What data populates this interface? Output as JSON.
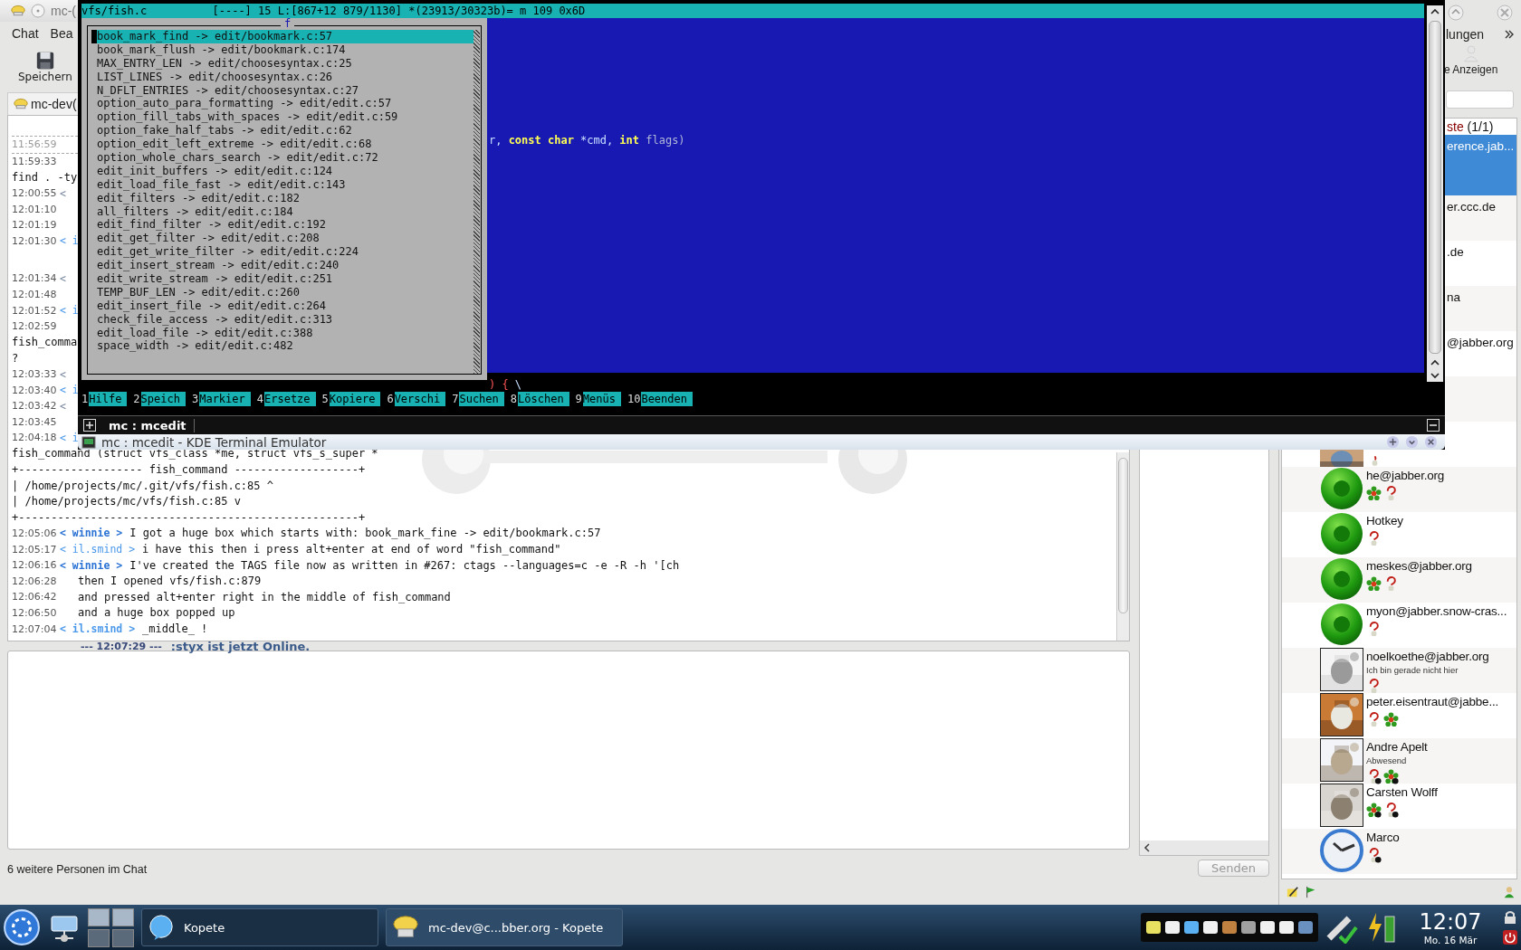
{
  "chat_window": {
    "title": "mc-(",
    "menu": [
      "Chat",
      "Bea"
    ],
    "toolbar": [
      {
        "label": "Speichern"
      }
    ],
    "tab": "mc-dev(",
    "log": [
      {
        "kind": "divider",
        "time": "11:56:59"
      },
      {
        "kind": "time",
        "time": "11:59:33"
      },
      {
        "kind": "text",
        "text": "find . -ty"
      },
      {
        "kind": "message",
        "time": "12:00:55",
        "nick": "<"
      },
      {
        "kind": "time",
        "time": "12:01:10"
      },
      {
        "kind": "time",
        "time": "12:01:19"
      },
      {
        "kind": "message",
        "time": "12:01:30",
        "nick": "< i",
        "color": "#4a98ea"
      },
      {
        "kind": "blank"
      },
      {
        "kind": "message",
        "time": "12:01:34",
        "nick": "<"
      },
      {
        "kind": "time",
        "time": "12:01:48"
      },
      {
        "kind": "message",
        "time": "12:01:52",
        "nick": "< i",
        "color": "#4a98ea"
      },
      {
        "kind": "time",
        "time": "12:02:59"
      },
      {
        "kind": "text",
        "text": "fish_comma"
      },
      {
        "kind": "text",
        "text": "?"
      },
      {
        "kind": "message",
        "time": "12:03:33",
        "nick": "<"
      },
      {
        "kind": "message",
        "time": "12:03:40",
        "nick": "< i",
        "color": "#4a98ea"
      },
      {
        "kind": "message",
        "time": "12:03:42",
        "nick": "<"
      },
      {
        "kind": "time",
        "time": "12:03:45"
      },
      {
        "kind": "message",
        "time": "12:04:18",
        "nick": "< i",
        "color": "#4a98ea"
      },
      {
        "kind": "text",
        "text": "fish_command (struct vfs_class *me, struct vfs_s_super *"
      },
      {
        "kind": "text",
        "text": "+------------------- fish_command -------------------+"
      },
      {
        "kind": "text",
        "text": "| /home/projects/mc/.git/vfs/fish.c:85 ^"
      },
      {
        "kind": "text",
        "text": "| /home/projects/mc/vfs/fish.c:85 v"
      },
      {
        "kind": "text",
        "text": "+----------------------------------------------------+"
      },
      {
        "kind": "message",
        "time": "12:05:06",
        "nick": "< winnie >",
        "color": "#2a72d4",
        "text": "I got a huge box which starts with: book_mark_fine -> edit/bookmark.c:57"
      },
      {
        "kind": "message",
        "time": "12:05:17",
        "nick": "< il.smind >",
        "color": "#4a98ea",
        "text": "i have this then i press alt+enter at end of word \"fish_command\""
      },
      {
        "kind": "message",
        "time": "12:06:16",
        "nick": "< winnie >",
        "color": "#2a72d4",
        "text": "I've created the TAGS file now as written in #267: ctags --languages=c -e -R -h '[ch"
      },
      {
        "kind": "continuation",
        "time": "12:06:28",
        "text": "then I opened vfs/fish.c:879"
      },
      {
        "kind": "continuation",
        "time": "12:06:42",
        "text": "and pressed alt+enter right in the middle of fish_command"
      },
      {
        "kind": "continuation",
        "time": "12:06:50",
        "text": "and a huge box popped up"
      },
      {
        "kind": "message",
        "time": "12:07:04",
        "nick": "< il.smind >",
        "color": "#4a98ea",
        "text": "_middle_ !"
      },
      {
        "kind": "system",
        "time": "--- 12:07:29 ---",
        "text": ":styx ist jetzt Online."
      }
    ],
    "status": "6 weitere Personen im Chat",
    "send_button": "Senden"
  },
  "terminal": {
    "status_line": "vfs/fish.c          [----] 15 L:[867+12 879/1130] *(23913/30323b)= m 109 0x6D",
    "popup": {
      "title": "f",
      "items": [
        {
          "text": "book_mark_find -> edit/bookmark.c:57",
          "selected": true
        },
        {
          "text": "book_mark_flush -> edit/bookmark.c:174",
          "selected": false
        },
        {
          "text": "MAX_ENTRY_LEN -> edit/choosesyntax.c:25",
          "selected": false
        },
        {
          "text": "LIST_LINES -> edit/choosesyntax.c:26",
          "selected": false
        },
        {
          "text": "N_DFLT_ENTRIES -> edit/choosesyntax.c:27",
          "selected": false
        },
        {
          "text": "option_auto_para_formatting -> edit/edit.c:57",
          "selected": false
        },
        {
          "text": "option_fill_tabs_with_spaces -> edit/edit.c:59",
          "selected": false
        },
        {
          "text": "option_fake_half_tabs -> edit/edit.c:62",
          "selected": false
        },
        {
          "text": "option_edit_left_extreme -> edit/edit.c:68",
          "selected": false
        },
        {
          "text": "option_whole_chars_search -> edit/edit.c:72",
          "selected": false
        },
        {
          "text": "edit_init_buffers -> edit/edit.c:124",
          "selected": false
        },
        {
          "text": "edit_load_file_fast -> edit/edit.c:143",
          "selected": false
        },
        {
          "text": "edit_filters -> edit/edit.c:182",
          "selected": false
        },
        {
          "text": "all_filters -> edit/edit.c:184",
          "selected": false
        },
        {
          "text": "edit_find_filter -> edit/edit.c:192",
          "selected": false
        },
        {
          "text": "edit_get_filter -> edit/edit.c:208",
          "selected": false
        },
        {
          "text": "edit_get_write_filter -> edit/edit.c:224",
          "selected": false
        },
        {
          "text": "edit_insert_stream -> edit/edit.c:240",
          "selected": false
        },
        {
          "text": "edit_write_stream -> edit/edit.c:251",
          "selected": false
        },
        {
          "text": "TEMP_BUF_LEN -> edit/edit.c:260",
          "selected": false
        },
        {
          "text": "edit_insert_file -> edit/edit.c:264",
          "selected": false
        },
        {
          "text": "check_file_access -> edit/edit.c:313",
          "selected": false
        },
        {
          "text": "edit_load_file -> edit/edit.c:388",
          "selected": false
        },
        {
          "text": "space_width -> edit/edit.c:482",
          "selected": false
        }
      ]
    },
    "code_lines": [
      [
        {
          "kind": "plain",
          "text": "r,"
        },
        {
          "kind": "keyword",
          "text": "const"
        },
        {
          "kind": "keyword",
          "text": "char"
        },
        {
          "kind": "plain",
          "text": "*cmd,"
        },
        {
          "kind": "keyword",
          "text": "int"
        },
        {
          "kind": "dim",
          "text": "flags)"
        }
      ],
      [
        {
          "kind": "brace",
          "text": ")"
        },
        {
          "kind": "brace",
          "text": "{"
        },
        {
          "kind": "plain",
          "text": "\\"
        }
      ]
    ],
    "function_keys": [
      {
        "key": "1",
        "label": "Hilfe"
      },
      {
        "key": "2",
        "label": "Speich"
      },
      {
        "key": "3",
        "label": "Markier"
      },
      {
        "key": "4",
        "label": "Ersetze"
      },
      {
        "key": "5",
        "label": "Kopiere"
      },
      {
        "key": "6",
        "label": "Verschi"
      },
      {
        "key": "7",
        "label": "Suchen"
      },
      {
        "key": "8",
        "label": "Löschen"
      },
      {
        "key": "9",
        "label": "Menüs"
      },
      {
        "key": "10",
        "label": "Beenden"
      }
    ],
    "tab": "mc : mcedit",
    "title": "mc : mcedit - KDE Terminal Emulator"
  },
  "contact_window": {
    "menu": "lungen",
    "toolbar": "e Anzeigen",
    "rows": [
      {
        "kind": "group",
        "text": "ste",
        "count": "(1/1)"
      },
      {
        "kind": "partial",
        "name": "erence.jab...",
        "selected": true
      },
      {
        "kind": "partial",
        "name": "er.ccc.de",
        "selected": false
      },
      {
        "kind": "partial",
        "name": ".de",
        "selected": false
      },
      {
        "kind": "partial",
        "name": "na",
        "selected": false
      },
      {
        "kind": "partial",
        "name": "@jabber.org",
        "selected": false
      },
      {
        "kind": "blank"
      },
      {
        "kind": "avatar_only",
        "avatar": {
          "kind": "picture"
        },
        "icons": [
          {
            "kind": "bulb"
          }
        ]
      },
      {
        "kind": "contact",
        "name": "he@jabber.org",
        "avatar": {
          "kind": "orb"
        },
        "icons": [
          {
            "kind": "flower"
          },
          {
            "kind": "bulb"
          }
        ]
      },
      {
        "kind": "contact",
        "name": "Hotkey",
        "avatar": {
          "kind": "orb"
        },
        "icons": [
          {
            "kind": "bulb"
          }
        ]
      },
      {
        "kind": "contact",
        "name": "meskes@jabber.org",
        "avatar": {
          "kind": "orb"
        },
        "icons": [
          {
            "kind": "flower"
          },
          {
            "kind": "bulb"
          }
        ]
      },
      {
        "kind": "contact",
        "name": "myon@jabber.snow-cras...",
        "avatar": {
          "kind": "orb"
        },
        "icons": [
          {
            "kind": "bulb"
          }
        ]
      },
      {
        "kind": "contact",
        "name": "noelkoethe@jabber.org",
        "status": "Ich bin gerade nicht hier",
        "avatar": {
          "kind": "picture"
        },
        "icons": [
          {
            "kind": "bulb"
          }
        ]
      },
      {
        "kind": "contact",
        "name": "peter.eisentraut@jabbe...",
        "avatar": {
          "kind": "picture"
        },
        "icons": [
          {
            "kind": "bulb"
          },
          {
            "kind": "flower"
          }
        ]
      },
      {
        "kind": "contact",
        "name": "Andre Apelt",
        "status": "Abwesend",
        "avatar": {
          "kind": "picture"
        },
        "icons": [
          {
            "kind": "bulb-away"
          },
          {
            "kind": "flower-away"
          }
        ]
      },
      {
        "kind": "contact",
        "name": "Carsten Wolff",
        "avatar": {
          "kind": "picture"
        },
        "icons": [
          {
            "kind": "flower-away"
          },
          {
            "kind": "bulb-away"
          }
        ]
      },
      {
        "kind": "contact",
        "name": "Marco",
        "avatar": {
          "kind": "clock"
        },
        "icons": [
          {
            "kind": "bulb-away"
          }
        ]
      }
    ]
  },
  "taskbar": {
    "tasks": [
      {
        "label": "Kopete",
        "selected": false
      },
      {
        "label": "mc-dev@c...bber.org - Kopete",
        "selected": true
      }
    ],
    "clock": {
      "time": "12:07",
      "date": "Mo. 16 Mär"
    }
  }
}
